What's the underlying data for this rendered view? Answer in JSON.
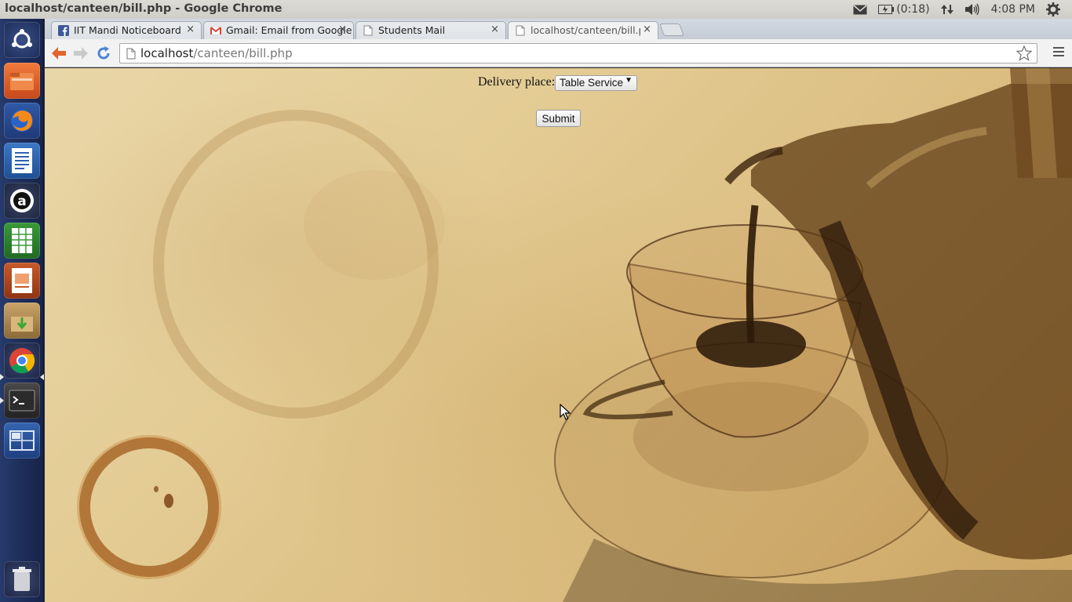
{
  "window": {
    "title": "localhost/canteen/bill.php - Google Chrome"
  },
  "system_panel": {
    "battery_text": "(0:18)",
    "clock": "4:08 PM",
    "icons": [
      "mail-icon",
      "battery-icon",
      "network-icon",
      "volume-icon",
      "settings-gear-icon"
    ]
  },
  "launcher": {
    "items": [
      "ubuntu-dash",
      "files",
      "firefox",
      "libreoffice-writer",
      "amazon",
      "libreoffice-calc",
      "libreoffice-impress",
      "software-updater",
      "chrome",
      "terminal",
      "workspace-switcher",
      "trash"
    ]
  },
  "tabs": [
    {
      "label": "IIT Mandi Noticeboard",
      "favicon": "facebook-icon"
    },
    {
      "label": "Gmail: Email from Google",
      "favicon": "gmail-icon"
    },
    {
      "label": "Students Mail",
      "favicon": "page-icon"
    },
    {
      "label": "localhost/canteen/bill.php",
      "favicon": "page-icon",
      "active": true
    }
  ],
  "tab_close_glyph": "×",
  "omnibox": {
    "host": "localhost",
    "path": "/canteen/bill.php"
  },
  "form": {
    "delivery_label": "Delivery place:",
    "delivery_selected": "Table Service",
    "select_arrow": "▼",
    "submit_label": "Submit"
  }
}
